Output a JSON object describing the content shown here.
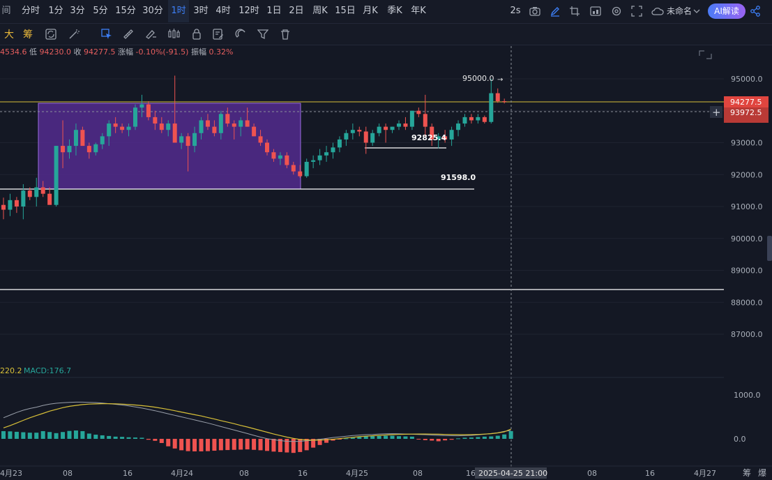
{
  "toolbar": {
    "timeframes": [
      "分时",
      "1分",
      "3分",
      "5分",
      "15分",
      "30分",
      "1时",
      "3时",
      "4时",
      "12时",
      "1日",
      "2日",
      "周K",
      "15日",
      "月K",
      "季K",
      "年K"
    ],
    "active_timeframe": "1时",
    "left_glyph": "间",
    "refresh": "2s",
    "layout_name": "未命名",
    "ai_button": "AI解读",
    "tool_labels": [
      "大",
      "筹"
    ],
    "bottom_right": [
      "筹",
      "爆"
    ]
  },
  "ohlc": {
    "high_value": "4534.6",
    "low_label": "低",
    "low_value": "94230.0",
    "close_label": "收",
    "close_value": "94277.5",
    "change_label": "涨幅",
    "change_value": "-0.10%(-91.5)",
    "amp_label": "振幅",
    "amp_value": "0.32%"
  },
  "macd": {
    "dea_value": "220.2",
    "macd_label": "MACD:176.7"
  },
  "annotations": {
    "high_mark": "95000.0",
    "mid_mark": "92825.4",
    "low_mark": "91598.0"
  },
  "crosshair": {
    "price_label": "93972.5",
    "time_label": "2025-04-25 21:00"
  },
  "colors": {
    "up": "#26a69a",
    "down": "#ef5350",
    "box_fill": "#5b2d9c",
    "accent": "#3d7ff7",
    "price_line": "#d8c038"
  },
  "chart_data": {
    "type": "candlestick",
    "price_axis": [
      "95000.0",
      "94000.0",
      "93000.0",
      "92000.0",
      "91000.0",
      "90000.0",
      "89000.0",
      "88000.0",
      "87000.0"
    ],
    "macd_axis": [
      "1000.0",
      "0.0"
    ],
    "x_ticks": [
      "4月23",
      "08",
      "16",
      "4月24",
      "08",
      "16",
      "4月25",
      "08",
      "16",
      "08",
      "16",
      "4月27"
    ],
    "current_price": 94277.5,
    "current_price_label": "94277.5",
    "horizontal_levels": [
      91598.0,
      88400.0
    ],
    "candles": [
      [
        91050,
        91280,
        90600,
        90900
      ],
      [
        90900,
        91400,
        90700,
        91200
      ],
      [
        91200,
        91300,
        90800,
        91000
      ],
      [
        91000,
        91700,
        90600,
        91500
      ],
      [
        91500,
        91600,
        91200,
        91300
      ],
      [
        91300,
        91900,
        91000,
        91600
      ],
      [
        91600,
        91800,
        91300,
        91400
      ],
      [
        91400,
        91600,
        91100,
        91050
      ],
      [
        91050,
        92900,
        91000,
        92900
      ],
      [
        92900,
        93700,
        92200,
        92700
      ],
      [
        92700,
        93100,
        92500,
        92900
      ],
      [
        92900,
        93600,
        92600,
        93400
      ],
      [
        93400,
        93500,
        92900,
        92900
      ],
      [
        92900,
        93000,
        92500,
        92700
      ],
      [
        92700,
        93000,
        92600,
        92950
      ],
      [
        92950,
        93300,
        92800,
        93200
      ],
      [
        93200,
        93700,
        92900,
        93600
      ],
      [
        93600,
        93800,
        93300,
        93500
      ],
      [
        93500,
        93600,
        93300,
        93400
      ],
      [
        93400,
        93600,
        93200,
        93500
      ],
      [
        93500,
        94200,
        93400,
        94100
      ],
      [
        94100,
        94500,
        93800,
        94200
      ],
      [
        94200,
        94300,
        93700,
        93800
      ],
      [
        93800,
        94000,
        93400,
        93600
      ],
      [
        93600,
        93800,
        93300,
        93400
      ],
      [
        93400,
        93700,
        93200,
        93600
      ],
      [
        93600,
        95100,
        93000,
        93000
      ],
      [
        93000,
        93300,
        92800,
        93200
      ],
      [
        93200,
        93300,
        92100,
        92900
      ],
      [
        92900,
        93500,
        92700,
        93300
      ],
      [
        93300,
        93800,
        93100,
        93700
      ],
      [
        93700,
        93900,
        93400,
        93500
      ],
      [
        93500,
        93700,
        93200,
        93300
      ],
      [
        93300,
        94000,
        93100,
        93900
      ],
      [
        93900,
        94100,
        93500,
        93600
      ],
      [
        93600,
        93700,
        93100,
        93500
      ],
      [
        93500,
        93800,
        93200,
        93700
      ],
      [
        93700,
        94100,
        93500,
        93500
      ],
      [
        93500,
        93600,
        93200,
        93200
      ],
      [
        93200,
        93400,
        92900,
        93000
      ],
      [
        93000,
        93100,
        92600,
        92700
      ],
      [
        92700,
        92800,
        92400,
        92500
      ],
      [
        92500,
        92700,
        92300,
        92600
      ],
      [
        92600,
        92700,
        92200,
        92300
      ],
      [
        92300,
        92400,
        92000,
        92100
      ],
      [
        92100,
        92300,
        91900,
        91950
      ],
      [
        91950,
        92500,
        91900,
        92400
      ],
      [
        92400,
        92600,
        92200,
        92450
      ],
      [
        92450,
        92800,
        92300,
        92600
      ],
      [
        92600,
        92900,
        92400,
        92700
      ],
      [
        92700,
        93000,
        92500,
        92850
      ],
      [
        92850,
        93200,
        92700,
        93100
      ],
      [
        93100,
        93400,
        92900,
        93300
      ],
      [
        93300,
        93600,
        93100,
        93400
      ],
      [
        93400,
        93500,
        93200,
        93350
      ],
      [
        93350,
        93500,
        92650,
        93000
      ],
      [
        93000,
        93400,
        92900,
        93300
      ],
      [
        93300,
        93600,
        93200,
        93500
      ],
      [
        93500,
        93600,
        93000,
        93400
      ],
      [
        93400,
        93500,
        93300,
        93500
      ],
      [
        93500,
        93700,
        93400,
        93600
      ],
      [
        93600,
        93800,
        93400,
        93500
      ],
      [
        93500,
        94000,
        93400,
        94000
      ],
      [
        94000,
        94100,
        93800,
        93900
      ],
      [
        93900,
        94500,
        93200,
        93500
      ],
      [
        93500,
        93600,
        92900,
        93100
      ],
      [
        93100,
        93300,
        92825,
        93200
      ],
      [
        93200,
        93400,
        93000,
        93100
      ],
      [
        93100,
        93500,
        92900,
        93400
      ],
      [
        93400,
        93700,
        93200,
        93600
      ],
      [
        93600,
        93900,
        93500,
        93800
      ],
      [
        93800,
        93900,
        93600,
        93700
      ],
      [
        93700,
        93900,
        93600,
        93800
      ],
      [
        93800,
        93850,
        93600,
        93650
      ],
      [
        93650,
        95000,
        93600,
        94550
      ],
      [
        94550,
        94700,
        94250,
        94300
      ],
      [
        94300,
        94380,
        94230,
        94277.5
      ]
    ],
    "macd_hist": [
      175,
      170,
      160,
      150,
      140,
      140,
      175,
      155,
      130,
      155,
      180,
      190,
      175,
      120,
      95,
      80,
      65,
      50,
      45,
      35,
      30,
      25,
      -20,
      -45,
      -95,
      -170,
      -220,
      -260,
      -280,
      -285,
      -285,
      -280,
      -270,
      -260,
      -255,
      -250,
      -245,
      -240,
      -250,
      -260,
      -275,
      -290,
      -300,
      -310,
      -320,
      -300,
      -260,
      -200,
      -140,
      -90,
      -40,
      -10,
      10,
      25,
      40,
      55,
      60,
      65,
      70,
      70,
      60,
      55,
      50,
      -15,
      -30,
      -40,
      -55,
      -35,
      -20,
      10,
      25,
      30,
      40,
      50,
      55,
      70,
      100,
      176.7
    ],
    "macd_dif": [
      480,
      540,
      600,
      650,
      690,
      720,
      760,
      790,
      810,
      820,
      830,
      835,
      835,
      830,
      825,
      815,
      800,
      785,
      770,
      750,
      725,
      700,
      670,
      640,
      605,
      570,
      535,
      500,
      465,
      430,
      395,
      360,
      320,
      280,
      240,
      200,
      160,
      120,
      80,
      40,
      5,
      -20,
      -40,
      -55,
      -60,
      -55,
      -45,
      -30,
      -10,
      10,
      30,
      45,
      60,
      75,
      85,
      95,
      100,
      110,
      115,
      118,
      115,
      110,
      105,
      100,
      95,
      88,
      80,
      75,
      72,
      70,
      75,
      80,
      90,
      105,
      120,
      140,
      170,
      190
    ],
    "macd_dea": [
      250,
      300,
      360,
      420,
      480,
      530,
      580,
      630,
      670,
      710,
      740,
      760,
      780,
      790,
      795,
      800,
      800,
      795,
      790,
      780,
      770,
      755,
      740,
      720,
      695,
      670,
      640,
      610,
      580,
      550,
      520,
      485,
      450,
      415,
      380,
      345,
      305,
      270,
      230,
      190,
      150,
      110,
      75,
      40,
      10,
      -15,
      -25,
      -30,
      -28,
      -20,
      -10,
      5,
      20,
      35,
      50,
      60,
      70,
      80,
      88,
      95,
      100,
      105,
      108,
      110,
      110,
      108,
      105,
      100,
      97,
      95,
      94,
      95,
      100,
      108,
      118,
      135,
      160,
      220.2
    ]
  }
}
